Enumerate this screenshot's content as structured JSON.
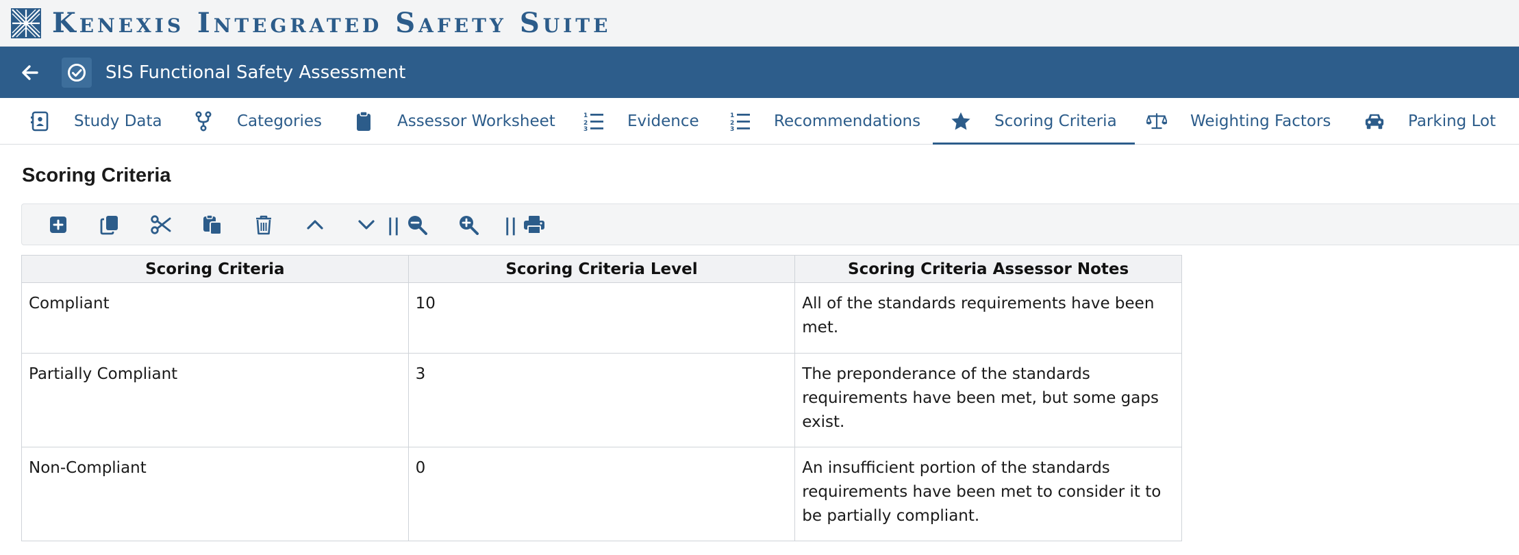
{
  "brand": {
    "title": "Kenexis Integrated Safety Suite"
  },
  "header": {
    "title": "SIS Functional Safety Assessment",
    "back_icon": "arrow-left-icon",
    "app_icon": "check-circle-icon"
  },
  "tabs": [
    {
      "label": "Study Data",
      "icon": "id-card-icon",
      "active": false
    },
    {
      "label": "Categories",
      "icon": "branch-icon",
      "active": false
    },
    {
      "label": "Assessor Worksheet",
      "icon": "clipboard-icon",
      "active": false
    },
    {
      "label": "Evidence",
      "icon": "numbered-list-icon",
      "active": false
    },
    {
      "label": "Recommendations",
      "icon": "numbered-list-icon",
      "active": false
    },
    {
      "label": "Scoring Criteria",
      "icon": "star-icon",
      "active": true
    },
    {
      "label": "Weighting Factors",
      "icon": "scale-icon",
      "active": false
    },
    {
      "label": "Parking Lot",
      "icon": "car-icon",
      "active": false
    }
  ],
  "section": {
    "title": "Scoring Criteria"
  },
  "toolbar": {
    "buttons": [
      "add-icon",
      "copy-icon",
      "cut-icon",
      "paste-icon",
      "delete-icon",
      "move-up-icon",
      "move-down-icon",
      "zoom-out-icon",
      "zoom-in-icon",
      "print-icon"
    ],
    "separator": "||"
  },
  "table": {
    "headers": [
      "Scoring Criteria",
      "Scoring Criteria Level",
      "Scoring Criteria Assessor Notes"
    ],
    "rows": [
      [
        "Compliant",
        "10",
        "All of the standards requirements have been met."
      ],
      [
        "Partially Compliant",
        "3",
        "The preponderance of the standards requirements have been met, but some gaps exist."
      ],
      [
        "Non-Compliant",
        "0",
        "An insufficient portion of the standards requirements have been met to consider it to be partially compliant."
      ]
    ]
  },
  "colors": {
    "brand_blue": "#2c5c8a",
    "header_bg": "#2d5d8b"
  }
}
